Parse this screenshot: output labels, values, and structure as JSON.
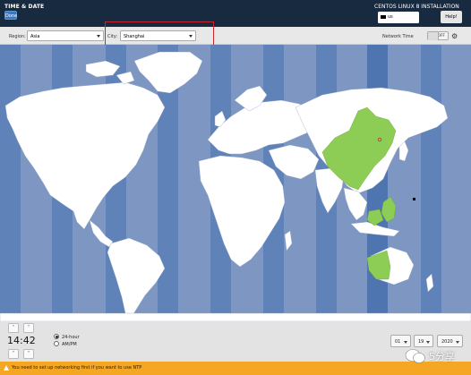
{
  "header": {
    "title": "TIME & DATE",
    "done_label": "Done",
    "install_title": "CENTOS LINUX 8 INSTALLATION",
    "keyboard_layout": "us",
    "help_label": "Help!"
  },
  "toolbar": {
    "region_label": "Region:",
    "region_value": "Asia",
    "city_label": "City:",
    "city_value": "Shanghai",
    "network_time_label": "Network Time",
    "network_time_state": "OFF"
  },
  "map": {
    "ocean_color": "#7d97c2",
    "band_color": "#5f82b8",
    "land_color": "#ffffff",
    "selected_zone_color": "#8dcc55",
    "selected_city_marker_color": "#cc2b2b"
  },
  "time": {
    "value": "14:42",
    "format_24h_label": "24-hour",
    "format_ampm_label": "AM/PM",
    "selected_format": "24-hour",
    "up_icon": "arrow-up-icon",
    "down_icon": "arrow-down-icon"
  },
  "date": {
    "month": "01",
    "day": "19",
    "year": "2020"
  },
  "warning": {
    "text": "You need to set up networking first if you want to use NTP"
  },
  "watermark": {
    "text": "5分享"
  }
}
